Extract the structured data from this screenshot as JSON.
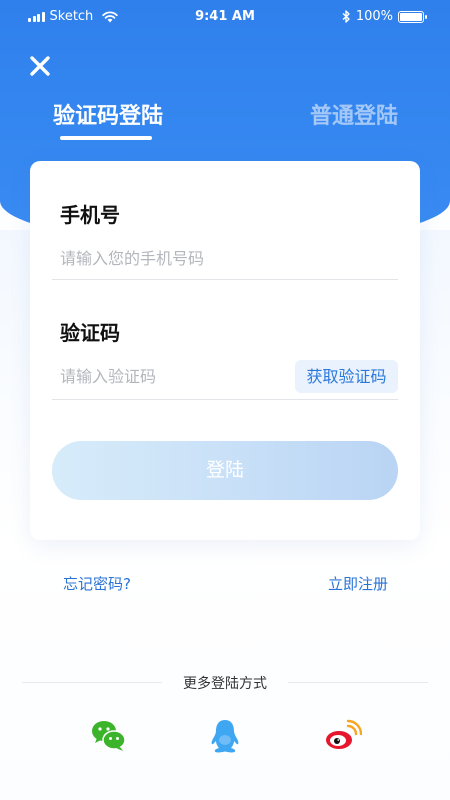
{
  "status_bar": {
    "carrier": "Sketch",
    "time": "9:41 AM",
    "battery": "100%",
    "icons": [
      "signal-icon",
      "wifi-icon",
      "bluetooth-icon",
      "battery-icon"
    ]
  },
  "header": {
    "close_icon": "close-icon",
    "tabs": [
      {
        "label": "验证码登陆",
        "active": true
      },
      {
        "label": "普通登陆",
        "active": false
      }
    ]
  },
  "form": {
    "phone": {
      "label": "手机号",
      "placeholder": "请输入您的手机号码",
      "value": ""
    },
    "code": {
      "label": "验证码",
      "placeholder": "请输入验证码",
      "value": "",
      "get_code_label": "获取验证码"
    },
    "submit_label": "登陆"
  },
  "links": {
    "forgot": "忘记密码?",
    "register": "立即注册"
  },
  "more": {
    "title": "更多登陆方式",
    "options": [
      "wechat-icon",
      "qq-icon",
      "weibo-icon"
    ]
  },
  "colors": {
    "primary": "#2f80ec",
    "link": "#2a73d6",
    "wechat": "#3bb32b",
    "qq": "#3fa6f2",
    "weibo": "#e6162d"
  }
}
